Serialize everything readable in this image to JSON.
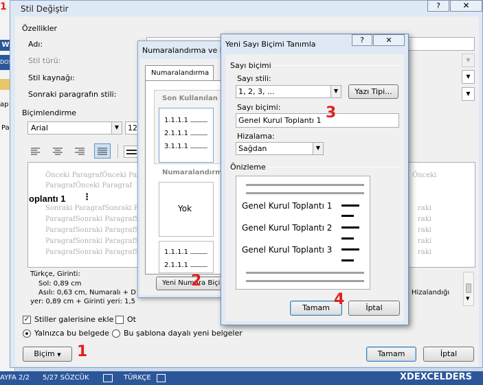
{
  "background": {
    "word_icon": "W",
    "dos_label": "DOS",
    "corner_mark": "1",
    "letters": [
      "ap",
      "Pa"
    ]
  },
  "main_dialog": {
    "title": "Stil Değiştir",
    "help_label": "?",
    "close_label": "✕",
    "ozellikler_label": "Özellikler",
    "adi_label": "Adı:",
    "stil_turu_label": "Stil türü:",
    "stil_kaynagi_label": "Stil kaynağı:",
    "sonraki_label": "Sonraki paragrafın stili:",
    "bicimlendirme_label": "Biçimlendirme",
    "font_name": "Arial",
    "font_size": "12",
    "preview": {
      "prev_lines": [
        "Önceki ParagrafÖnceki Paragraf",
        "ParagrafÖnceki Paragraf"
      ],
      "prev_right": "Önceki",
      "sample_text": "oplantı 1",
      "next_lines": [
        "Sonraki ParagrafSonraki Paragraf",
        "ParagrafSonraki ParagrafSonraki",
        "ParagrafSonraki ParagrafSonraki",
        "ParagrafSonraki ParagrafSonraki",
        "ParagrafSonraki ParagrafSonraki"
      ],
      "next_right": [
        "raki",
        "raki",
        "raki",
        "raki",
        "raki"
      ]
    },
    "desc": {
      "line1": "Türkçe, Girinti:",
      "line2": "Sol:  0,89 cm",
      "line3": "Asılı:  0,63 cm, Numaralı + D",
      "line4": "yer:  0,89 cm + Girinti yeri:  1,5",
      "right": "Hizalandığı"
    },
    "stiller_galeri_label": "Stiller galerisine ekle",
    "stiller_galeri_checked": true,
    "oto_label": "Ot",
    "yalnizca_label": "Yalnızca bu belgede",
    "sablon_label": "Bu şablona dayalı yeni belgeler",
    "bicim_button": "Biçim",
    "tamam_button": "Tamam",
    "iptal_button": "İptal"
  },
  "numaralandirma_dialog": {
    "title": "Numaralandırma ve N",
    "tab_label": "Numaralandırma",
    "son_kullanilan": "Son Kullanılan S",
    "list_items": [
      "1.1.1.1",
      "2.1.1.1",
      "3.1.1.1"
    ],
    "kutuphane": "Numaralandırm",
    "yok_label": "Yok",
    "list2_items": [
      "1.1.1.1",
      "2.1.1.1"
    ],
    "yeni_numara_button": "Yeni Numara Biçi"
  },
  "yeni_sayi_dialog": {
    "title": "Yeni Sayı Biçimi Tanımla",
    "help_label": "?",
    "close_label": "✕",
    "sayi_bicimi_group": "Sayı biçimi",
    "sayi_stili_label": "Sayı stili:",
    "sayi_stili_value": "1, 2, 3, ...",
    "yazi_tipi_button": "Yazı Tipi...",
    "sayi_bicimi_label": "Sayı biçimi:",
    "sayi_bicimi_value": "Genel Kurul Toplantı 1",
    "hizalama_label": "Hizalama:",
    "hizalama_value": "Sağdan",
    "onizleme_label": "Önizleme",
    "preview_items": [
      "Genel Kurul Toplantı 1",
      "Genel Kurul Toplantı 2",
      "Genel Kurul Toplantı 3"
    ],
    "tamam_button": "Tamam",
    "iptal_button": "İptal"
  },
  "annotations": {
    "step1": "1",
    "step2": "2",
    "step3": "3",
    "step4": "4",
    "color": "#e02020"
  },
  "status_bar": {
    "page": "AYFA 2/2",
    "words": "5/27 SÖZCÜK",
    "language": "TÜRKÇE",
    "brand": "XDEXCELDERS"
  }
}
